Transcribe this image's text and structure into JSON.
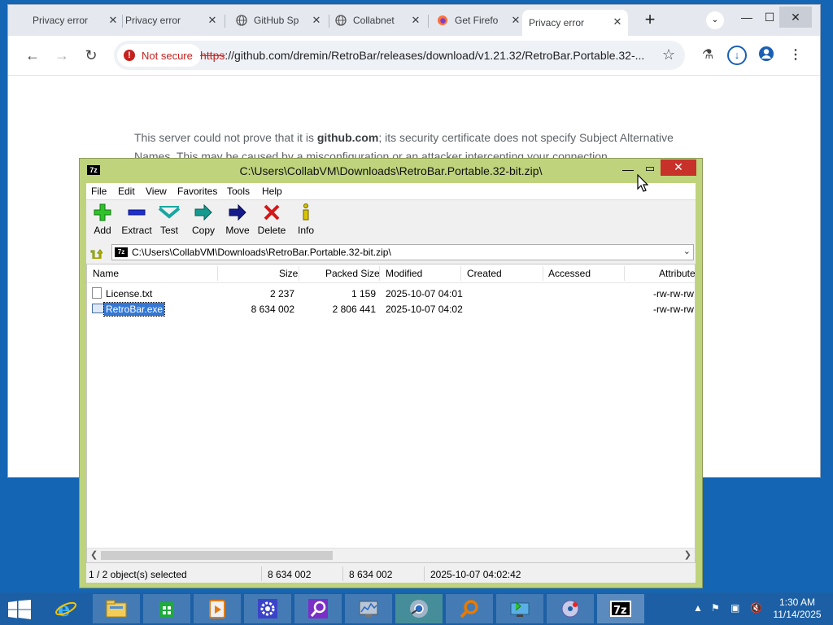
{
  "browser": {
    "tabs": [
      {
        "title": "Privacy error",
        "active": false
      },
      {
        "title": "Privacy error",
        "active": false
      },
      {
        "title": "GitHub Sp",
        "active": false
      },
      {
        "title": "Collabnet",
        "active": false
      },
      {
        "title": "Get Firefo",
        "active": false
      },
      {
        "title": "Privacy error",
        "active": true
      }
    ],
    "not_secure_label": "Not secure",
    "url_scheme": "https",
    "url_rest": "://github.com/dremin/RetroBar/releases/download/v1.21.32/RetroBar.Portable.32-...",
    "error_text_before": "This server could not prove that it is ",
    "error_text_bold": "github.com",
    "error_text_after": "; its security certificate does not specify Subject Alternative Names. This may be caused by a misconfiguration or an attacker intercepting your connection."
  },
  "zip": {
    "title": "C:\\Users\\CollabVM\\Downloads\\RetroBar.Portable.32-bit.zip\\",
    "menu": [
      "File",
      "Edit",
      "View",
      "Favorites",
      "Tools",
      "Help"
    ],
    "toolbar": [
      "Add",
      "Extract",
      "Test",
      "Copy",
      "Move",
      "Delete",
      "Info"
    ],
    "path": "C:\\Users\\CollabVM\\Downloads\\RetroBar.Portable.32-bit.zip\\",
    "columns": [
      "Name",
      "Size",
      "Packed Size",
      "Modified",
      "Created",
      "Accessed",
      "Attribute"
    ],
    "files": [
      {
        "name": "License.txt",
        "size": "2 237",
        "packed": "1 159",
        "modified": "2025-10-07 04:01",
        "created": "",
        "accessed": "",
        "attr": "-rw-rw-rw",
        "selected": false
      },
      {
        "name": "RetroBar.exe",
        "size": "8 634 002",
        "packed": "2 806 441",
        "modified": "2025-10-07 04:02",
        "created": "",
        "accessed": "",
        "attr": "-rw-rw-rw",
        "selected": true
      }
    ],
    "status": {
      "selection": "1 / 2 object(s) selected",
      "size": "8 634 002",
      "packed": "8 634 002",
      "modified": "2025-10-07 04:02:42"
    }
  },
  "taskbar": {
    "time": "1:30 AM",
    "date": "11/14/2025"
  }
}
